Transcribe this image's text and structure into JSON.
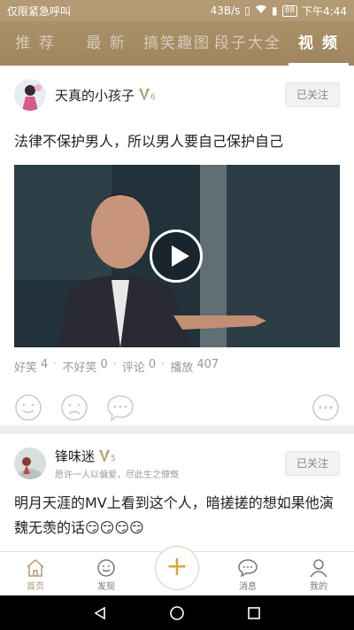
{
  "status_bar": {
    "carrier": "仅限紧急呼叫",
    "speed": "43B/s",
    "battery": "88",
    "time": "下午4:44"
  },
  "tabs": [
    {
      "label": "推 荐",
      "active": false
    },
    {
      "label": "最 新",
      "active": false
    },
    {
      "label": "搞笑趣图",
      "active": false
    },
    {
      "label": "段子大全",
      "active": false
    },
    {
      "label": "视 频",
      "active": true
    }
  ],
  "posts": [
    {
      "username": "天真的小孩子",
      "level": "6",
      "follow_label": "已关注",
      "text": "法律不保护男人，所以男人要自己保护自己",
      "stats": {
        "funny_label": "好笑",
        "funny": "4",
        "notfunny_label": "不好笑",
        "notfunny": "0",
        "comment_label": "评论",
        "comment": "0",
        "play_label": "播放",
        "play": "407"
      }
    },
    {
      "username": "锋味迷",
      "level": "5",
      "signature": "愿许一人以偏爱，尽此生之慷慨",
      "follow_label": "已关注",
      "text": "明月天涯的MV上看到这个人，暗搓搓的想如果他演魏无羡的话😏😏😏😏"
    }
  ],
  "bottom_nav": {
    "home": "首页",
    "discover": "发现",
    "add": "+",
    "messages": "消息",
    "me": "我的"
  },
  "colors": {
    "brand": "#b39a74",
    "add_accent": "#d4a73c"
  }
}
